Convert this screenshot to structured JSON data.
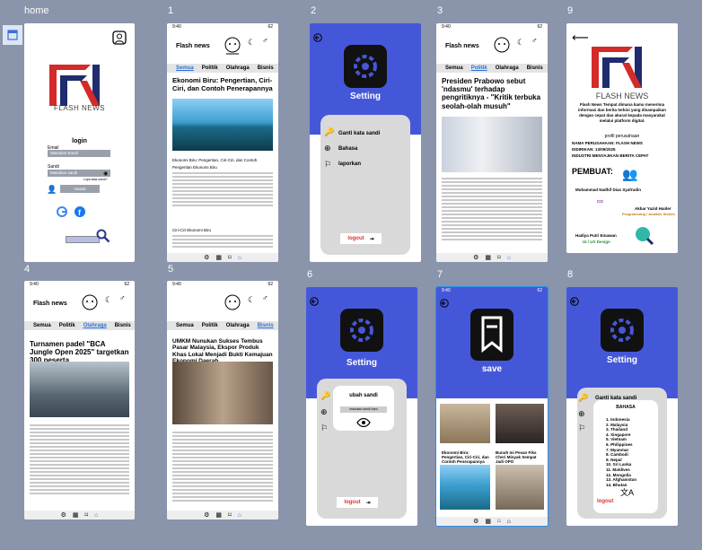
{
  "labels": {
    "home": "home",
    "f1": "1",
    "f2": "2",
    "f3": "3",
    "f9": "9",
    "f4": "4",
    "f5": "5",
    "f6": "6",
    "f7": "7",
    "f8": "8"
  },
  "home": {
    "brand": "FLASH NEWS",
    "login": "login",
    "email_label": "Email",
    "email_placeholder": "Masukan Email",
    "pass_label": "Sandi",
    "pass_placeholder": "Masukan sandi",
    "forgot": "Lupa kata sandi?",
    "submit": "masuk"
  },
  "status": {
    "time": "9:40",
    "battery": "62"
  },
  "app": {
    "brand": "Flash news",
    "tabs": [
      "Semua",
      "Politik",
      "Olahraga",
      "Bisnis"
    ]
  },
  "f1": {
    "title": "Ekonomi Biru: Pengertian, Ciri-Ciri, dan Contoh Penerapannya",
    "sub": "Ekonomi Biru: Pengertian, Ciri-Ciri, dan Contoh",
    "sub2": "Pengertian Ekonomi Biru",
    "sub3": "Ciri-Ciri Ekonomi Biru"
  },
  "f3": {
    "title": "Presiden Prabowo sebut 'ndasmu' terhadap pengritiknya - \"Kritik terbuka seolah-olah musuh\""
  },
  "f4": {
    "title": "Turnamen padel \"BCA Jungle Open 2025\" targetkan 300 peserta"
  },
  "f5": {
    "title": "UMKM Nunukan Sukses Tembus Pasar Malaysia, Ekspor Produk Khas Lokal Menjadi Bukti Kemajuan Ekonomi Daerah"
  },
  "settings": {
    "title": "Setting",
    "change_pw": "Ganti kata sandi",
    "language": "Bahasa",
    "report": "laporkan",
    "logout": "logout"
  },
  "f6": {
    "dialog": "ubah sandi",
    "placeholder": "masukan sandi baru"
  },
  "f7": {
    "title": "save",
    "a1": "Ekonomi Biru: Pengertian, Ciri-Ciri, dan Contoh Penerapannya",
    "a2": "Bunuh Ini Pesan Fiks Cheri Minyak Sempat Jadi OPO"
  },
  "f8": {
    "lang_title": "BAHASA",
    "languages": [
      "1. Indonesia",
      "2. Malaysia",
      "3. Thailand",
      "4. Singapore",
      "5. Vietnam",
      "6. Philippines",
      "7. Myanmar",
      "8. Cambodi",
      "9. Nepal",
      "10. Sri Lanka",
      "11. Maldives",
      "12. Mongolia",
      "13. Afghanistan",
      "14. Bhutan"
    ]
  },
  "f9": {
    "brand": "FLASH NEWS",
    "desc": "Flash News Tempat dimana kamu menerima informasi dan berita terkini yang disampaikan dengan cepat dan akurat kepada masyarakat melalui platform digital.",
    "profil": "profil perusahaan",
    "company": "NAMA PERUSAHAAN: FLASH NEWS",
    "date": "DIDIRIKAN: 13/09/2025",
    "industry": "INDUSTRI:MENYAJIKAN BERITA CEPAT",
    "made_by": "PEMBUAT:",
    "p1_name": "Muhammad Nadhif Dias Syafrudin",
    "p1_role": "CO",
    "p2_name": "Akbar Yazid Haider",
    "p2_role": "Programming / Analisis Sistem",
    "p3_name": "Hadiya Putri Einawan",
    "p3_role": "UI / UX Design"
  }
}
